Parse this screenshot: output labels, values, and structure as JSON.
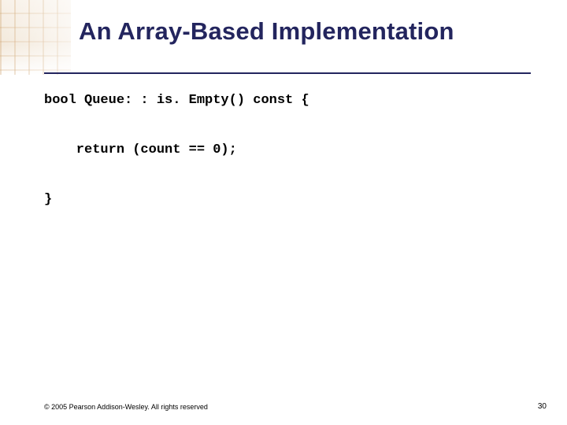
{
  "title": "An Array-Based Implementation",
  "code": {
    "line1": "bool Queue: : is. Empty() const {",
    "line2": "    return (count == 0);",
    "line3": "}"
  },
  "copyright": "© 2005 Pearson Addison-Wesley. All rights reserved",
  "page_number": "30"
}
